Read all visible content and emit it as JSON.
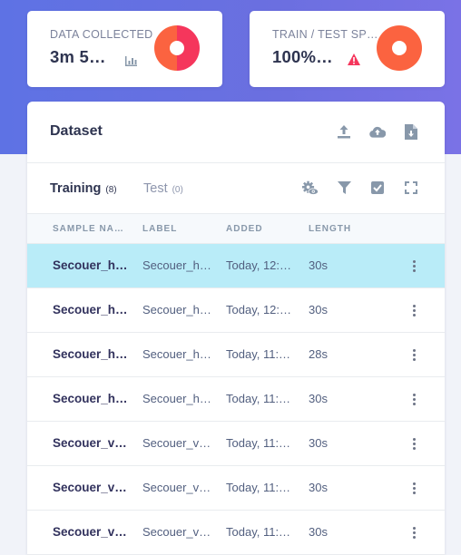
{
  "stats": {
    "collected": {
      "title": "DATA COLLECTED",
      "value": "3m 5…",
      "icon": "bar-chart-icon"
    },
    "split": {
      "title": "TRAIN / TEST SP…",
      "value": "100%…",
      "icon": "warning-icon"
    }
  },
  "colors": {
    "accent": "#5e72e4",
    "donut_red": "#f5365c",
    "donut_orange": "#fb6340",
    "warning": "#f5365c",
    "selected_row": "#b9ecf8"
  },
  "dataset": {
    "title": "Dataset",
    "header_icons": [
      "upload-icon",
      "cloud-upload-icon",
      "download-file-icon"
    ],
    "tabs": [
      {
        "label": "Training",
        "count": "(8)"
      },
      {
        "label": "Test",
        "count": "(0)"
      }
    ],
    "tab_icons": [
      "settings-view-icon",
      "filter-icon",
      "select-checkbox-icon",
      "fullscreen-icon"
    ],
    "columns": [
      "SAMPLE NA…",
      "LABEL",
      "ADDED",
      "LENGTH"
    ],
    "rows": [
      {
        "name": "Secouer_h…",
        "label": "Secouer_h…",
        "added": "Today, 12:…",
        "length": "30s",
        "selected": true
      },
      {
        "name": "Secouer_h…",
        "label": "Secouer_h…",
        "added": "Today, 12:…",
        "length": "30s"
      },
      {
        "name": "Secouer_h…",
        "label": "Secouer_h…",
        "added": "Today, 11:…",
        "length": "28s"
      },
      {
        "name": "Secouer_h…",
        "label": "Secouer_h…",
        "added": "Today, 11:…",
        "length": "30s"
      },
      {
        "name": "Secouer_v…",
        "label": "Secouer_v…",
        "added": "Today, 11:…",
        "length": "30s"
      },
      {
        "name": "Secouer_v…",
        "label": "Secouer_v…",
        "added": "Today, 11:…",
        "length": "30s"
      },
      {
        "name": "Secouer_v…",
        "label": "Secouer_v…",
        "added": "Today, 11:…",
        "length": "30s"
      }
    ]
  }
}
